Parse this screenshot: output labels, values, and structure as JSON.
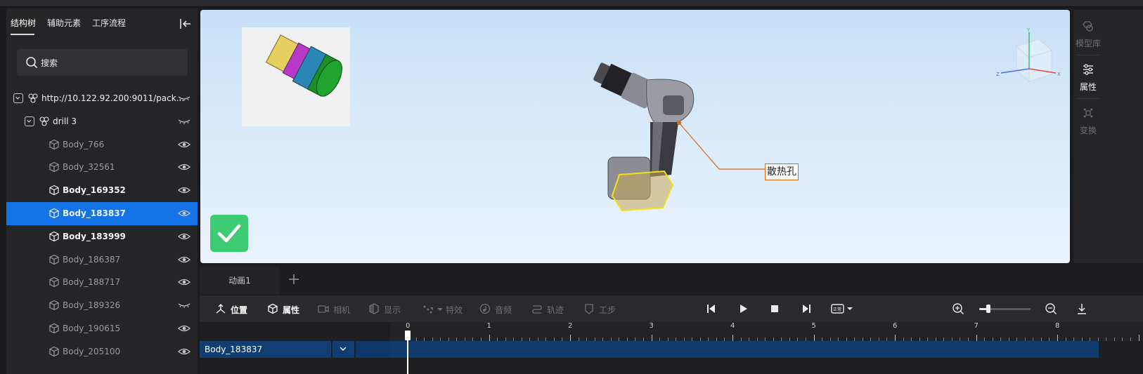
{
  "left_panel": {
    "tabs": [
      "结构树",
      "辅助元素",
      "工序流程"
    ],
    "search_label": "搜索",
    "tree": [
      {
        "label": "http://10.122.92.200:9011/pack...",
        "level": 0,
        "kind": "assembly",
        "expanded": true,
        "visibility": "hidden",
        "bright": true,
        "selected": false
      },
      {
        "label": "drill 3",
        "level": 1,
        "kind": "assembly",
        "expanded": true,
        "visibility": "hidden",
        "bright": true,
        "selected": false
      },
      {
        "label": "Body_766",
        "level": 2,
        "kind": "body",
        "visibility": "visible",
        "bright": false,
        "selected": false
      },
      {
        "label": "Body_32561",
        "level": 2,
        "kind": "body",
        "visibility": "visible",
        "bright": false,
        "selected": false
      },
      {
        "label": "Body_169352",
        "level": 2,
        "kind": "body",
        "visibility": "visible",
        "bright": true,
        "selected": false
      },
      {
        "label": "Body_183837",
        "level": 2,
        "kind": "body",
        "visibility": "visible",
        "bright": true,
        "selected": true
      },
      {
        "label": "Body_183999",
        "level": 2,
        "kind": "body",
        "visibility": "visible",
        "bright": true,
        "selected": false
      },
      {
        "label": "Body_186387",
        "level": 2,
        "kind": "body",
        "visibility": "visible",
        "bright": false,
        "selected": false
      },
      {
        "label": "Body_188717",
        "level": 2,
        "kind": "body",
        "visibility": "visible",
        "bright": false,
        "selected": false
      },
      {
        "label": "Body_189326",
        "level": 2,
        "kind": "body",
        "visibility": "hidden",
        "bright": false,
        "selected": false
      },
      {
        "label": "Body_190615",
        "level": 2,
        "kind": "body",
        "visibility": "visible",
        "bright": false,
        "selected": false
      },
      {
        "label": "Body_205100",
        "level": 2,
        "kind": "body",
        "visibility": "visible",
        "bright": false,
        "selected": false
      }
    ]
  },
  "viewport": {
    "annotation_text": "散热孔",
    "gizmo_axes": [
      "Y",
      "X",
      "Z"
    ]
  },
  "right_strip": {
    "buttons": [
      {
        "label": "模型库",
        "active": false
      },
      {
        "label": "属性",
        "active": true
      },
      {
        "label": "变换",
        "active": false
      }
    ]
  },
  "animation": {
    "tabs": [
      {
        "label": "动画1"
      }
    ],
    "toolbar": [
      {
        "label": "位置",
        "icon": "position-icon",
        "enabled": true
      },
      {
        "label": "属性",
        "icon": "cube-icon",
        "enabled": true
      },
      {
        "label": "相机",
        "icon": "camera-icon",
        "enabled": false
      },
      {
        "label": "显示",
        "icon": "display-icon",
        "enabled": false
      },
      {
        "label": "特效",
        "icon": "effects-icon",
        "enabled": false
      },
      {
        "label": "音频",
        "icon": "audio-icon",
        "enabled": false
      },
      {
        "label": "轨迹",
        "icon": "trajectory-icon",
        "enabled": false
      },
      {
        "label": "工步",
        "icon": "step-icon",
        "enabled": false
      }
    ],
    "speed_label": "正常",
    "zoom_level": 0.15,
    "ruler_ticks": [
      "0",
      "1",
      "2",
      "3",
      "4",
      "5",
      "6",
      "7",
      "8"
    ],
    "track": {
      "name": "Body_183837"
    }
  },
  "colors": {
    "accent": "#1473e6",
    "success": "#3dcc73",
    "annotation": "#d86a1a",
    "track": "#103e72"
  }
}
